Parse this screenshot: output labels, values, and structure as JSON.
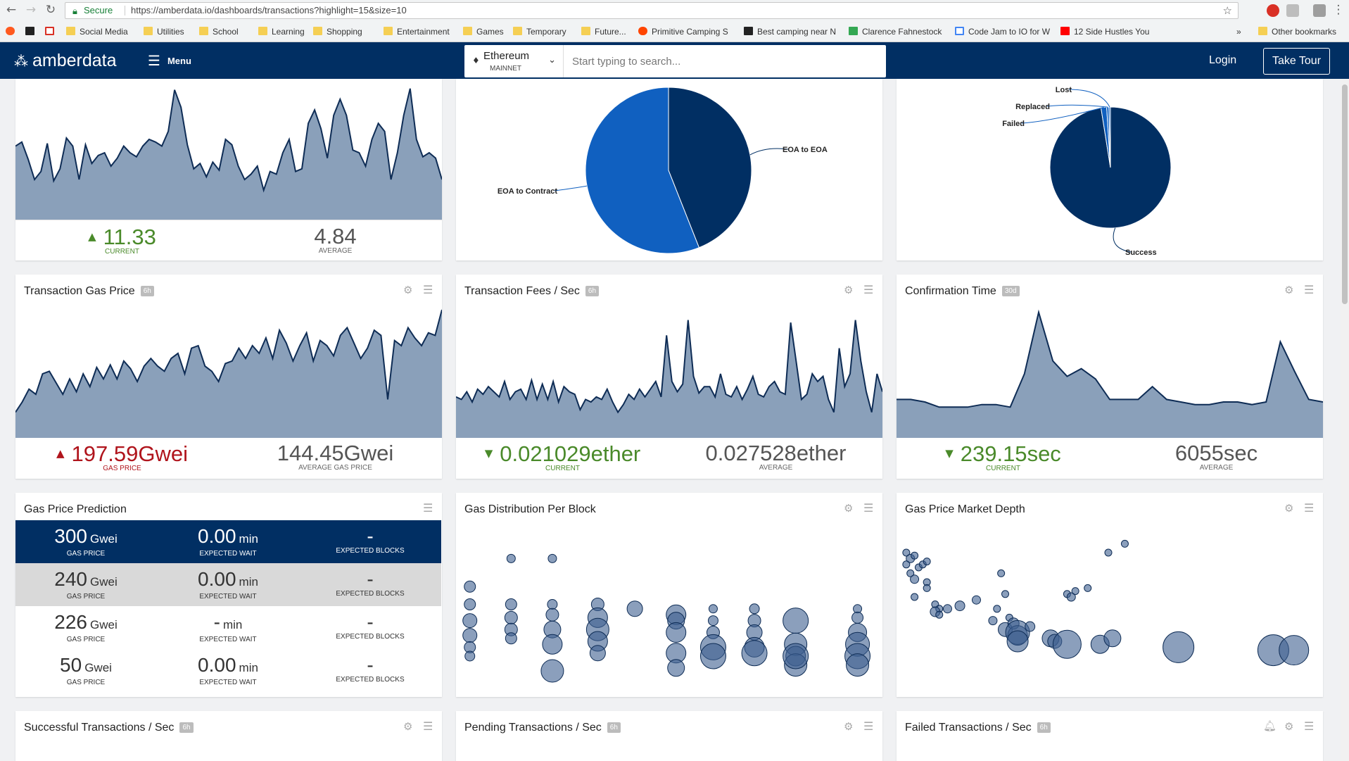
{
  "browser": {
    "secure_label": "Secure",
    "url": "https://amberdata.io/dashboards/transactions?highlight=15&size=10",
    "bookmarks": [
      "Social Media",
      "Utilities",
      "School",
      "Learning",
      "Shopping",
      "Entertainment",
      "Games",
      "Temporary",
      "Future...",
      "Primitive Camping S",
      "Best camping near N",
      "Clarence Fahnestock",
      "Code Jam to IO for W",
      "12 Side Hustles You"
    ],
    "overflow_label": "»",
    "other_bookmarks": "Other bookmarks"
  },
  "header": {
    "logo_text": "amberdata",
    "menu_label": "Menu",
    "network_name": "Ethereum",
    "network_sub": "MAINNET",
    "search_placeholder": "Start typing to search...",
    "login_label": "Login",
    "tour_label": "Take Tour"
  },
  "colors": {
    "navy": "#012f63",
    "area_fill": "#8aa0ba",
    "line": "#0e2c55",
    "pie_light": "#1060c0",
    "bubble": "#3d5f8f"
  },
  "cards": {
    "top_left": {
      "current": "11.33",
      "current_label": "CURRENT",
      "average": "4.84",
      "average_label": "AVERAGE"
    },
    "top_mid": {
      "chart_data": {
        "type": "pie",
        "labels": [
          "EOA to EOA",
          "EOA to Contract"
        ],
        "values": [
          44,
          56
        ]
      }
    },
    "top_right": {
      "chart_data": {
        "type": "pie",
        "labels": [
          "Success",
          "Failed",
          "Replaced",
          "Lost"
        ],
        "values": [
          97.5,
          1.5,
          0.6,
          0.4
        ]
      }
    },
    "gas_price": {
      "title": "Transaction Gas Price",
      "badge": "6h",
      "current": "197.59",
      "current_unit": "Gwei",
      "current_label": "GAS PRICE",
      "average": "144.45",
      "average_unit": "Gwei",
      "average_label": "AVERAGE GAS PRICE"
    },
    "fees": {
      "title": "Transaction Fees / Sec",
      "badge": "6h",
      "current": "0.021029",
      "current_unit": "ether",
      "current_label": "CURRENT",
      "average": "0.027528",
      "average_unit": "ether",
      "average_label": "AVERAGE"
    },
    "confirm": {
      "title": "Confirmation Time",
      "badge": "30d",
      "current": "239.15",
      "current_unit": "sec",
      "current_label": "CURRENT",
      "average": "6055",
      "average_unit": "sec",
      "average_label": "AVERAGE"
    },
    "prediction": {
      "title": "Gas Price Prediction",
      "rows": [
        {
          "price": "300",
          "price_unit": "Gwei",
          "price_label": "GAS PRICE",
          "wait": "0.00",
          "wait_unit": "min",
          "wait_label": "EXPECTED WAIT",
          "blocks": "-",
          "blocks_label": "EXPECTED BLOCKS"
        },
        {
          "price": "240",
          "price_unit": "Gwei",
          "price_label": "GAS PRICE",
          "wait": "0.00",
          "wait_unit": "min",
          "wait_label": "EXPECTED WAIT",
          "blocks": "-",
          "blocks_label": "EXPECTED BLOCKS"
        },
        {
          "price": "226",
          "price_unit": "Gwei",
          "price_label": "GAS PRICE",
          "wait": "-",
          "wait_unit": "min",
          "wait_label": "EXPECTED WAIT",
          "blocks": "-",
          "blocks_label": "EXPECTED BLOCKS"
        },
        {
          "price": "50",
          "price_unit": "Gwei",
          "price_label": "GAS PRICE",
          "wait": "0.00",
          "wait_unit": "min",
          "wait_label": "EXPECTED WAIT",
          "blocks": "-",
          "blocks_label": "EXPECTED BLOCKS"
        }
      ]
    },
    "distribution": {
      "title": "Gas Distribution Per Block"
    },
    "depth": {
      "title": "Gas Price Market Depth"
    },
    "successful": {
      "title": "Successful Transactions / Sec",
      "badge": "6h"
    },
    "pending": {
      "title": "Pending Transactions / Sec",
      "badge": "6h"
    },
    "failed": {
      "title": "Failed Transactions / Sec",
      "badge": "6h"
    }
  },
  "series": {
    "top_left": [
      0.55,
      0.58,
      0.45,
      0.3,
      0.36,
      0.57,
      0.29,
      0.38,
      0.61,
      0.55,
      0.3,
      0.56,
      0.42,
      0.48,
      0.5,
      0.4,
      0.46,
      0.55,
      0.5,
      0.47,
      0.55,
      0.6,
      0.58,
      0.55,
      0.66,
      0.97,
      0.84,
      0.56,
      0.38,
      0.42,
      0.32,
      0.43,
      0.37,
      0.6,
      0.56,
      0.4,
      0.3,
      0.34,
      0.4,
      0.22,
      0.36,
      0.34,
      0.5,
      0.6,
      0.36,
      0.38,
      0.72,
      0.82,
      0.68,
      0.46,
      0.78,
      0.9,
      0.78,
      0.52,
      0.5,
      0.4,
      0.6,
      0.72,
      0.66,
      0.3,
      0.5,
      0.78,
      0.98,
      0.6,
      0.47,
      0.5,
      0.46,
      0.3
    ],
    "gas_price": [
      0.2,
      0.28,
      0.38,
      0.34,
      0.5,
      0.52,
      0.43,
      0.34,
      0.46,
      0.36,
      0.5,
      0.4,
      0.55,
      0.46,
      0.57,
      0.46,
      0.6,
      0.54,
      0.44,
      0.56,
      0.62,
      0.56,
      0.52,
      0.62,
      0.66,
      0.5,
      0.7,
      0.72,
      0.56,
      0.52,
      0.44,
      0.58,
      0.6,
      0.7,
      0.62,
      0.72,
      0.66,
      0.78,
      0.62,
      0.84,
      0.74,
      0.6,
      0.72,
      0.82,
      0.6,
      0.76,
      0.72,
      0.64,
      0.8,
      0.86,
      0.74,
      0.62,
      0.7,
      0.84,
      0.8,
      0.3,
      0.76,
      0.72,
      0.86,
      0.78,
      0.72,
      0.82,
      0.8,
      1.0
    ],
    "fees": [
      0.32,
      0.3,
      0.36,
      0.28,
      0.38,
      0.34,
      0.4,
      0.36,
      0.32,
      0.44,
      0.3,
      0.36,
      0.38,
      0.3,
      0.45,
      0.3,
      0.42,
      0.3,
      0.44,
      0.28,
      0.4,
      0.36,
      0.34,
      0.22,
      0.3,
      0.28,
      0.32,
      0.3,
      0.38,
      0.28,
      0.2,
      0.26,
      0.34,
      0.3,
      0.38,
      0.32,
      0.38,
      0.44,
      0.32,
      0.8,
      0.44,
      0.36,
      0.42,
      0.92,
      0.48,
      0.35,
      0.4,
      0.4,
      0.32,
      0.5,
      0.34,
      0.32,
      0.4,
      0.3,
      0.38,
      0.48,
      0.34,
      0.32,
      0.4,
      0.44,
      0.36,
      0.34,
      0.9,
      0.6,
      0.3,
      0.34,
      0.5,
      0.44,
      0.48,
      0.3,
      0.2,
      0.7,
      0.4,
      0.5,
      0.92,
      0.6,
      0.36,
      0.2,
      0.5,
      0.36
    ],
    "confirm": [
      0.3,
      0.3,
      0.28,
      0.24,
      0.24,
      0.24,
      0.26,
      0.26,
      0.24,
      0.5,
      0.98,
      0.6,
      0.48,
      0.54,
      0.46,
      0.3,
      0.3,
      0.3,
      0.4,
      0.3,
      0.28,
      0.26,
      0.26,
      0.28,
      0.28,
      0.26,
      0.28,
      0.75,
      0.52,
      0.3,
      0.28
    ]
  },
  "bubbles": {
    "distribution": [
      [
        0.02,
        0.67,
        8
      ],
      [
        0.02,
        0.55,
        8
      ],
      [
        0.02,
        0.44,
        10
      ],
      [
        0.02,
        0.34,
        10
      ],
      [
        0.02,
        0.26,
        8
      ],
      [
        0.02,
        0.2,
        7
      ],
      [
        0.12,
        0.86,
        6
      ],
      [
        0.12,
        0.55,
        8
      ],
      [
        0.12,
        0.46,
        9
      ],
      [
        0.12,
        0.38,
        9
      ],
      [
        0.12,
        0.32,
        8
      ],
      [
        0.22,
        0.86,
        6
      ],
      [
        0.22,
        0.55,
        7
      ],
      [
        0.22,
        0.48,
        9
      ],
      [
        0.22,
        0.38,
        12
      ],
      [
        0.22,
        0.28,
        14
      ],
      [
        0.22,
        0.1,
        16
      ],
      [
        0.33,
        0.55,
        9
      ],
      [
        0.33,
        0.46,
        14
      ],
      [
        0.33,
        0.38,
        16
      ],
      [
        0.33,
        0.3,
        14
      ],
      [
        0.33,
        0.22,
        11
      ],
      [
        0.42,
        0.52,
        11
      ],
      [
        0.52,
        0.48,
        14
      ],
      [
        0.52,
        0.44,
        12
      ],
      [
        0.52,
        0.36,
        14
      ],
      [
        0.52,
        0.22,
        14
      ],
      [
        0.52,
        0.12,
        12
      ],
      [
        0.61,
        0.52,
        6
      ],
      [
        0.61,
        0.44,
        7
      ],
      [
        0.61,
        0.36,
        9
      ],
      [
        0.61,
        0.26,
        18
      ],
      [
        0.61,
        0.2,
        18
      ],
      [
        0.71,
        0.52,
        7
      ],
      [
        0.71,
        0.44,
        9
      ],
      [
        0.71,
        0.36,
        11
      ],
      [
        0.71,
        0.26,
        14
      ],
      [
        0.71,
        0.22,
        18
      ],
      [
        0.81,
        0.44,
        18
      ],
      [
        0.81,
        0.28,
        16
      ],
      [
        0.81,
        0.2,
        14
      ],
      [
        0.81,
        0.14,
        16
      ],
      [
        0.81,
        0.2,
        18
      ],
      [
        0.96,
        0.52,
        6
      ],
      [
        0.96,
        0.46,
        8
      ],
      [
        0.96,
        0.36,
        13
      ],
      [
        0.96,
        0.28,
        17
      ],
      [
        0.96,
        0.2,
        18
      ],
      [
        0.96,
        0.14,
        16
      ]
    ],
    "depth": [
      [
        0.01,
        0.9,
        5
      ],
      [
        0.02,
        0.86,
        6
      ],
      [
        0.03,
        0.88,
        5
      ],
      [
        0.01,
        0.82,
        5
      ],
      [
        0.04,
        0.8,
        5
      ],
      [
        0.05,
        0.82,
        5
      ],
      [
        0.06,
        0.84,
        5
      ],
      [
        0.02,
        0.76,
        5
      ],
      [
        0.03,
        0.72,
        6
      ],
      [
        0.06,
        0.7,
        5
      ],
      [
        0.06,
        0.66,
        5
      ],
      [
        0.03,
        0.6,
        5
      ],
      [
        0.08,
        0.55,
        5
      ],
      [
        0.09,
        0.52,
        5
      ],
      [
        0.08,
        0.5,
        7
      ],
      [
        0.09,
        0.48,
        5
      ],
      [
        0.11,
        0.52,
        6
      ],
      [
        0.14,
        0.54,
        7
      ],
      [
        0.18,
        0.58,
        6
      ],
      [
        0.22,
        0.44,
        6
      ],
      [
        0.23,
        0.52,
        5
      ],
      [
        0.26,
        0.46,
        5
      ],
      [
        0.25,
        0.38,
        10
      ],
      [
        0.27,
        0.42,
        8
      ],
      [
        0.28,
        0.34,
        14
      ],
      [
        0.28,
        0.36,
        17
      ],
      [
        0.28,
        0.3,
        15
      ],
      [
        0.25,
        0.62,
        5
      ],
      [
        0.24,
        0.76,
        5
      ],
      [
        0.31,
        0.4,
        7
      ],
      [
        0.36,
        0.32,
        12
      ],
      [
        0.37,
        0.3,
        10
      ],
      [
        0.4,
        0.28,
        20
      ],
      [
        0.4,
        0.62,
        5
      ],
      [
        0.41,
        0.6,
        6
      ],
      [
        0.42,
        0.64,
        5
      ],
      [
        0.45,
        0.66,
        5
      ],
      [
        0.48,
        0.28,
        13
      ],
      [
        0.51,
        0.32,
        12
      ],
      [
        0.5,
        0.9,
        5
      ],
      [
        0.54,
        0.96,
        5
      ],
      [
        0.67,
        0.26,
        22
      ],
      [
        0.9,
        0.24,
        22
      ],
      [
        0.95,
        0.24,
        21
      ]
    ]
  }
}
